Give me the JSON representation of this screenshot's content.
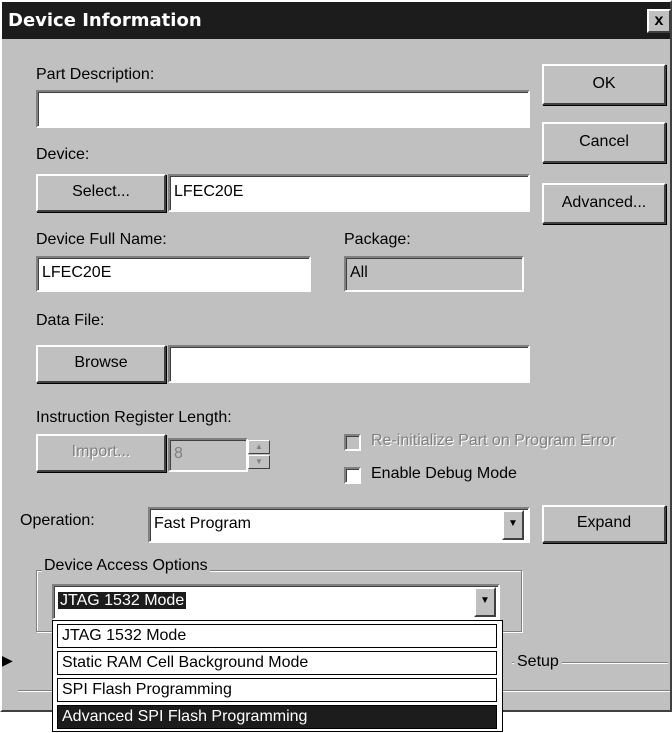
{
  "window": {
    "title": "Device Information",
    "close_label": "x"
  },
  "buttons": {
    "ok": "OK",
    "cancel": "Cancel",
    "advanced": "Advanced...",
    "select": "Select...",
    "browse": "Browse",
    "import": "Import...",
    "expand": "Expand"
  },
  "labels": {
    "part_description": "Part Description:",
    "device": "Device:",
    "device_full_name": "Device Full Name:",
    "package": "Package:",
    "data_file": "Data File:",
    "instruction_register_length": "Instruction Register Length:",
    "operation": "Operation:",
    "device_access_options": "Device Access Options",
    "setup": "Setup"
  },
  "fields": {
    "part_description": "",
    "device": "LFEC20E",
    "device_full_name": "LFEC20E",
    "package": "All",
    "data_file": "",
    "ir_length": "8",
    "operation": "Fast Program",
    "device_access": "JTAG 1532 Mode"
  },
  "checkboxes": {
    "reinitialize": "Re-initialize Part on Program Error",
    "debug_mode": "Enable Debug Mode"
  },
  "dropdown": {
    "options": [
      "JTAG 1532 Mode",
      "Static RAM Cell Background Mode",
      "SPI Flash Programming",
      "Advanced SPI Flash Programming"
    ],
    "highlighted": "Advanced SPI Flash Programming"
  },
  "colors": {
    "face": "#c0c0c0",
    "titlebar": "#1c1c1c",
    "highlight": "#1c1c1c"
  }
}
